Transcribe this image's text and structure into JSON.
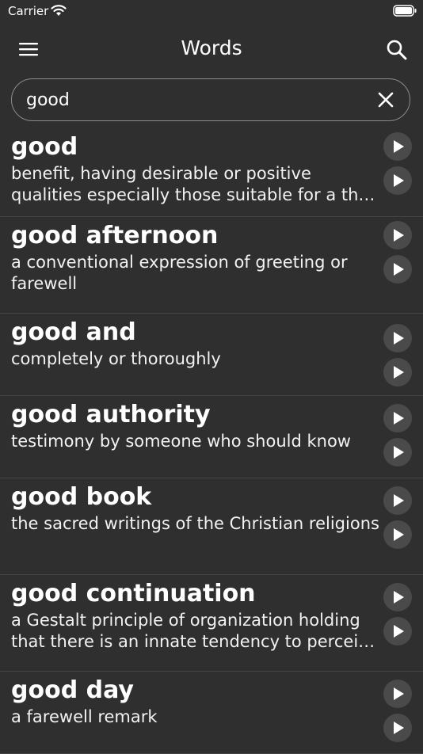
{
  "status_bar": {
    "carrier": "Carrier"
  },
  "nav": {
    "title": "Words"
  },
  "search": {
    "value": "good",
    "placeholder": ""
  },
  "entries": [
    {
      "word": "good",
      "definition": "benefit, having desirable or positive qualities especially those suitable for a th…"
    },
    {
      "word": "good afternoon",
      "definition": "a conventional expression of greeting or farewell"
    },
    {
      "word": "good and",
      "definition": "completely or thoroughly"
    },
    {
      "word": "good authority",
      "definition": "testimony by someone who should know"
    },
    {
      "word": "good book",
      "definition": "the sacred writings of the Christian religions"
    },
    {
      "word": "good continuation",
      "definition": "a Gestalt principle of organization holding that there is an innate tendency to percei…"
    },
    {
      "word": "good day",
      "definition": "a farewell remark"
    }
  ],
  "icons": {
    "menu": "hamburger-icon",
    "search": "search-icon",
    "clear": "close-icon",
    "play": "play-icon"
  },
  "colors": {
    "background": "#2f2f2f",
    "button": "#4a4a4a",
    "caret": "#3b82f6"
  }
}
